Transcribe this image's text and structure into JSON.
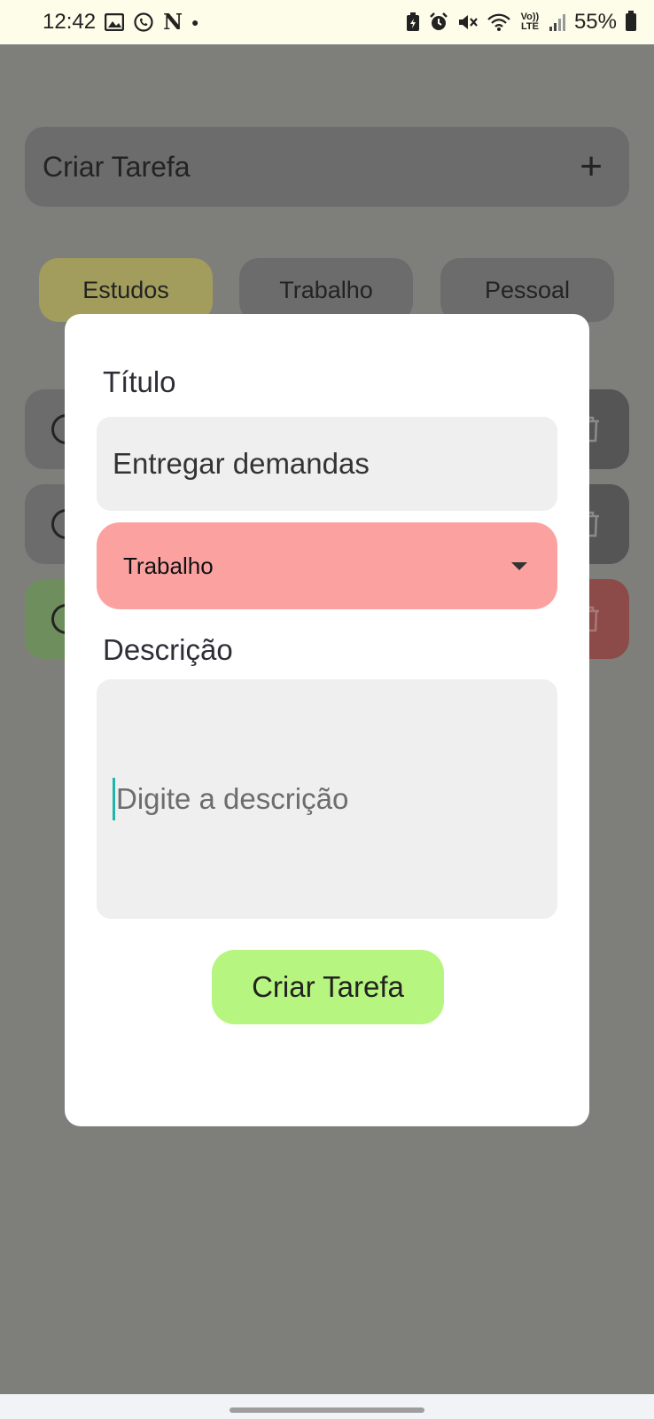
{
  "status_bar": {
    "time": "12:42",
    "battery_percent": "55%",
    "left_icons": [
      "gallery-icon",
      "whatsapp-icon",
      "netflix-icon",
      "dot-icon"
    ],
    "right_icons": [
      "battery-saver-icon",
      "alarm-icon",
      "mute-icon",
      "wifi-icon",
      "volte-icon",
      "signal-icon",
      "battery-icon"
    ],
    "netflix_glyph": "N",
    "volte_text": "Vo)) LTE"
  },
  "background": {
    "create_bar_label": "Criar Tarefa",
    "categories": [
      {
        "label": "Estudos"
      },
      {
        "label": "Trabalho"
      },
      {
        "label": "Pessoal"
      }
    ]
  },
  "modal": {
    "title_label": "Título",
    "title_value": "Entregar demandas",
    "category_selected": "Trabalho",
    "description_label": "Descrição",
    "description_placeholder": "Digite a descrição",
    "submit_label": "Criar Tarefa"
  },
  "colors": {
    "overlay": "#7e7f7b",
    "select_bg": "#fba2a1",
    "submit_bg": "#b6f57f",
    "cursor": "#1fb5a8"
  }
}
